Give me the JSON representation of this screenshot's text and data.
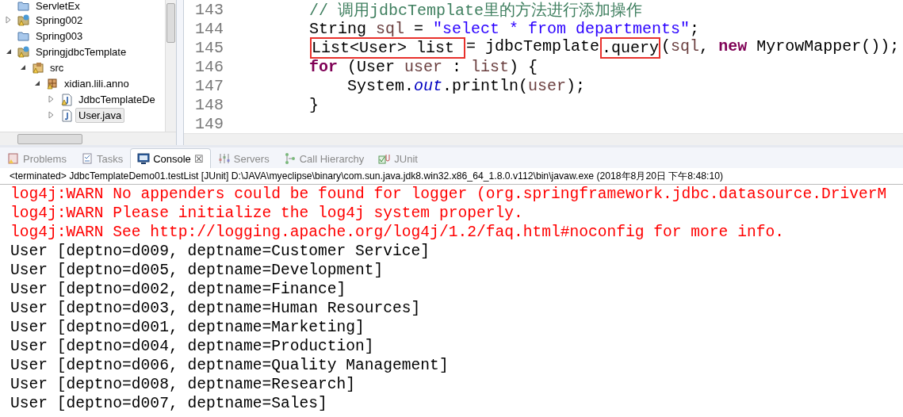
{
  "explorer": {
    "items": [
      {
        "label": "ServletEx",
        "kind": "folder",
        "warning": false
      },
      {
        "label": "Spring002",
        "kind": "project",
        "warning": true,
        "expanded": false
      },
      {
        "label": "Spring003",
        "kind": "folder",
        "warning": false
      },
      {
        "label": "SpringjdbcTemplate",
        "kind": "project",
        "warning": true,
        "expanded": true,
        "children": [
          {
            "label": "src",
            "kind": "source",
            "warning": true,
            "expanded": true,
            "children": [
              {
                "label": "xidian.lili.anno",
                "kind": "package",
                "warning": true,
                "expanded": true,
                "children": [
                  {
                    "label": "JdbcTemplateDe",
                    "kind": "java",
                    "warning": true,
                    "expanded": false,
                    "selected": false
                  },
                  {
                    "label": "User.java",
                    "kind": "java",
                    "warning": false,
                    "expanded": false,
                    "selected": true
                  }
                ]
              }
            ]
          }
        ]
      }
    ]
  },
  "editor": {
    "lines": [
      {
        "number": "143",
        "tokens": [
          {
            "text": "// 调用jdbcTemplate里的方法进行添加操作",
            "kind": "comment"
          }
        ]
      },
      {
        "number": "144",
        "tokens": [
          {
            "text": "String ",
            "kind": "plain"
          },
          {
            "text": "sql",
            "kind": "local"
          },
          {
            "text": " = ",
            "kind": "plain"
          },
          {
            "text": "\"select * from departments\"",
            "kind": "string"
          },
          {
            "text": ";",
            "kind": "plain"
          }
        ]
      },
      {
        "number": "145",
        "tokens": [
          {
            "text": "List<User> list ",
            "kind": "plain",
            "boxed": true
          },
          {
            "text": "= jdbcTemplate",
            "kind": "plain",
            "boxed": false
          },
          {
            "text": ".query",
            "kind": "plain",
            "boxed": true
          },
          {
            "text": "(",
            "kind": "plain"
          },
          {
            "text": "sql",
            "kind": "local"
          },
          {
            "text": ", ",
            "kind": "plain"
          },
          {
            "text": "new",
            "kind": "keyword"
          },
          {
            "text": " MyrowMapper());",
            "kind": "plain"
          }
        ]
      },
      {
        "number": "146",
        "tokens": [
          {
            "text": "for",
            "kind": "keyword"
          },
          {
            "text": " (User ",
            "kind": "plain"
          },
          {
            "text": "user",
            "kind": "local"
          },
          {
            "text": " : ",
            "kind": "plain"
          },
          {
            "text": "list",
            "kind": "local"
          },
          {
            "text": ") {",
            "kind": "plain"
          }
        ]
      },
      {
        "number": "147",
        "tokens": [
          {
            "text": "    System.",
            "kind": "plain"
          },
          {
            "text": "out",
            "kind": "field"
          },
          {
            "text": ".println(",
            "kind": "plain"
          },
          {
            "text": "user",
            "kind": "local"
          },
          {
            "text": ");",
            "kind": "plain"
          }
        ]
      },
      {
        "number": "148",
        "tokens": [
          {
            "text": "}",
            "kind": "plain"
          }
        ]
      },
      {
        "number": "149"
      }
    ]
  },
  "tabs": [
    {
      "label": "Problems",
      "selected": false
    },
    {
      "label": "Tasks",
      "selected": false
    },
    {
      "label": "Console",
      "selected": true,
      "close": "☒"
    },
    {
      "label": "Servers",
      "selected": false
    },
    {
      "label": "Call Hierarchy",
      "selected": false
    },
    {
      "label": "JUnit",
      "selected": false
    }
  ],
  "console": {
    "status": "<terminated> JdbcTemplateDemo01.testList [JUnit] D:\\JAVA\\myeclipse\\binary\\com.sun.java.jdk8.win32.x86_64_1.8.0.v112\\bin\\javaw.exe (2018年8月20日 下午8:48:10)",
    "lines": [
      {
        "text": "log4j:WARN No appenders could be found for logger (org.springframework.jdbc.datasource.DriverM",
        "kind": "error"
      },
      {
        "text": "log4j:WARN Please initialize the log4j system properly.",
        "kind": "error"
      },
      {
        "text": "log4j:WARN See http://logging.apache.org/log4j/1.2/faq.html#noconfig for more info.",
        "kind": "error"
      },
      {
        "text": "User [deptno=d009, deptname=Customer Service]",
        "kind": "out"
      },
      {
        "text": "User [deptno=d005, deptname=Development]",
        "kind": "out"
      },
      {
        "text": "User [deptno=d002, deptname=Finance]",
        "kind": "out"
      },
      {
        "text": "User [deptno=d003, deptname=Human Resources]",
        "kind": "out"
      },
      {
        "text": "User [deptno=d001, deptname=Marketing]",
        "kind": "out"
      },
      {
        "text": "User [deptno=d004, deptname=Production]",
        "kind": "out"
      },
      {
        "text": "User [deptno=d006, deptname=Quality Management]",
        "kind": "out"
      },
      {
        "text": "User [deptno=d008, deptname=Research]",
        "kind": "out"
      },
      {
        "text": "User [deptno=d007, deptname=Sales]",
        "kind": "out"
      }
    ]
  }
}
